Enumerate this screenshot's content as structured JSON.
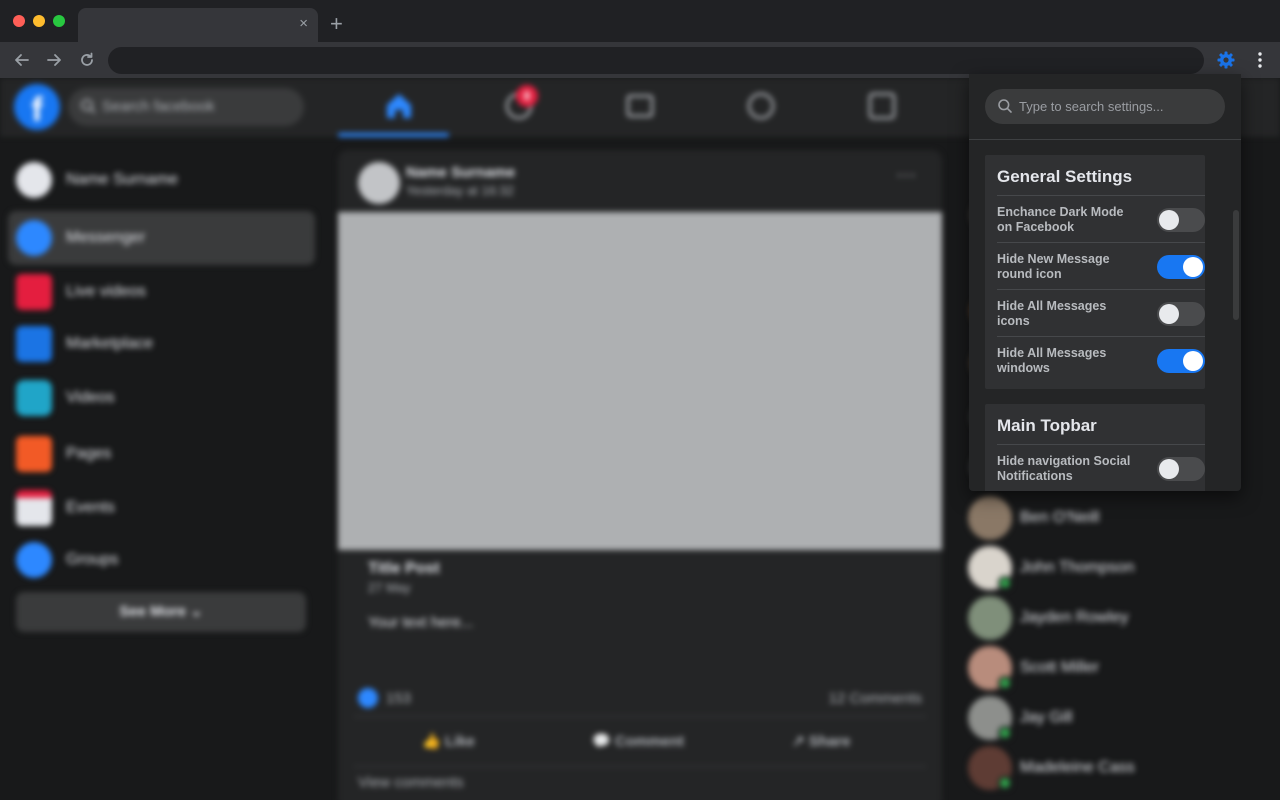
{
  "browser": {
    "tab_close": "×",
    "new_tab": "+"
  },
  "facebook": {
    "search_placeholder": "Search facebook",
    "notification_count": "8",
    "left_menu": [
      {
        "label": "Name Surname"
      },
      {
        "label": "Messenger"
      },
      {
        "label": "Live videos"
      },
      {
        "label": "Marketplace"
      },
      {
        "label": "Videos"
      },
      {
        "label": "Pages"
      },
      {
        "label": "Events"
      },
      {
        "label": "Groups"
      }
    ],
    "see_more": "See More",
    "post": {
      "author": "Name Surname",
      "time": "Yesterday at 16:32",
      "more": "···",
      "title": "Title Post",
      "date": "27 May",
      "text": "Your text here...",
      "likes": "153",
      "comments": "12 Comments",
      "actions": [
        "Like",
        "Comment",
        "Share"
      ],
      "view_comments": "View comments"
    },
    "contacts": [
      {
        "name": "Ben O'Neill",
        "online": false
      },
      {
        "name": "John Thompson",
        "online": true
      },
      {
        "name": "Jayden Rowley",
        "online": false
      },
      {
        "name": "Scott Miller",
        "online": true
      },
      {
        "name": "Jay Gill",
        "online": true
      },
      {
        "name": "Madeleine Cass",
        "online": true
      }
    ]
  },
  "popup": {
    "search_placeholder": "Type to search settings...",
    "sections": [
      {
        "title": "General Settings",
        "settings": [
          {
            "label": "Enchance Dark Mode on Facebook",
            "enabled": false
          },
          {
            "label": "Hide New Message round icon",
            "enabled": true
          },
          {
            "label": "Hide All Messages icons",
            "enabled": false
          },
          {
            "label": "Hide All Messages windows",
            "enabled": true
          }
        ]
      },
      {
        "title": "Main Topbar",
        "settings": [
          {
            "label": "Hide navigation Social Notifications",
            "enabled": false
          }
        ]
      }
    ]
  },
  "colors": {
    "accent": "#1877f2",
    "popup_bg": "#242526",
    "card_bg": "#303133",
    "toggle_off": "#4a4b4d"
  }
}
